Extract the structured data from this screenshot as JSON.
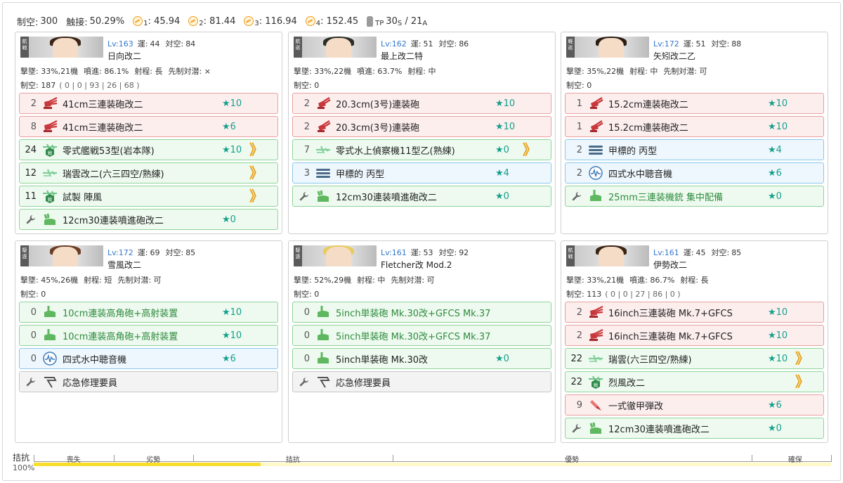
{
  "fleet": {
    "air_power_label": "制空:",
    "air_power": "300",
    "contact_label": "触接:",
    "contact": "50.29%",
    "formations": [
      {
        "sub": "1",
        "value": ": 45.94"
      },
      {
        "sub": "2",
        "value": ": 81.44"
      },
      {
        "sub": "3",
        "value": ": 116.94"
      },
      {
        "sub": "4",
        "value": ": 152.45"
      }
    ],
    "tp_label": "TP",
    "tp_s": "30",
    "tp_s_sub": "S",
    "tp_sep": " / ",
    "tp_a": "21",
    "tp_a_sub": "A"
  },
  "ships": [
    {
      "tag": "航戦",
      "lv": "Lv:163",
      "luck_k": "運:",
      "luck": "44",
      "aa_k": "対空:",
      "aa": "84",
      "name": "日向改二",
      "stats": [
        "撃墜: 33%,21機",
        "噴進: 86.1%",
        "射程: 長",
        "先制対潜: ×"
      ],
      "airpower_label": "制空:",
      "airpower": "187",
      "airpower_detail": "( 0 | 0 | 93 | 26 | 68 )",
      "hair": "#3a2418",
      "slots": [
        {
          "color": "red",
          "count": "2",
          "icon": "main-gun",
          "name": "41cm三連装砲改二",
          "star": "★10",
          "prof": ""
        },
        {
          "color": "red",
          "count": "8",
          "icon": "main-gun",
          "name": "41cm三連装砲改二",
          "star": "★6",
          "prof": ""
        },
        {
          "color": "green",
          "count": "24",
          "icon": "fighter-bomber",
          "name": "零式艦戦53型(岩本隊)",
          "star": "★10",
          "prof": "》"
        },
        {
          "color": "green",
          "count": "12",
          "icon": "seaplane",
          "name": "瑞雲改二(六三四空/熟練)",
          "star": "",
          "prof": "》"
        },
        {
          "color": "green",
          "count": "11",
          "icon": "fighter-bomber",
          "name": "試製 陣風",
          "star": "",
          "prof": "》"
        },
        {
          "color": "green",
          "count": "",
          "icon": "rocket-launcher",
          "name": "12cm30連装噴進砲改二",
          "star": "★0",
          "prof": "",
          "ex": true
        }
      ]
    },
    {
      "tag": "航巡",
      "lv": "Lv:162",
      "luck_k": "運:",
      "luck": "51",
      "aa_k": "対空:",
      "aa": "86",
      "name": "最上改二特",
      "stats": [
        "撃墜: 33%,22機",
        "噴進: 63.7%",
        "射程: 中"
      ],
      "airpower_label": "制空:",
      "airpower": "0",
      "airpower_detail": "",
      "hair": "#2a2e26",
      "slots": [
        {
          "color": "red",
          "count": "2",
          "icon": "medium-gun",
          "name": "20.3cm(3号)連装砲",
          "star": "★10",
          "prof": ""
        },
        {
          "color": "red",
          "count": "2",
          "icon": "medium-gun",
          "name": "20.3cm(3号)連装砲",
          "star": "★10",
          "prof": ""
        },
        {
          "color": "green",
          "count": "7",
          "icon": "seaplane",
          "name": "零式水上偵察機11型乙(熟練)",
          "star": "★0",
          "prof": "》"
        },
        {
          "color": "blue",
          "count": "3",
          "icon": "midget-sub",
          "name": "甲標的 丙型",
          "star": "★4",
          "prof": ""
        },
        {
          "color": "green",
          "count": "",
          "icon": "rocket-launcher",
          "name": "12cm30連装噴進砲改二",
          "star": "★0",
          "prof": "",
          "ex": true
        }
      ]
    },
    {
      "tag": "軽巡",
      "lv": "Lv:172",
      "luck_k": "運:",
      "luck": "51",
      "aa_k": "対空:",
      "aa": "88",
      "name": "矢矧改二乙",
      "stats": [
        "撃墜: 35%,22機",
        "射程: 中",
        "先制対潜: 可"
      ],
      "airpower_label": "制空:",
      "airpower": "0",
      "airpower_detail": "",
      "hair": "#2b1c14",
      "slots": [
        {
          "color": "red",
          "count": "1",
          "icon": "medium-gun",
          "name": "15.2cm連装砲改二",
          "star": "★10",
          "prof": ""
        },
        {
          "color": "red",
          "count": "1",
          "icon": "medium-gun",
          "name": "15.2cm連装砲改二",
          "star": "★10",
          "prof": ""
        },
        {
          "color": "blue",
          "count": "2",
          "icon": "midget-sub",
          "name": "甲標的 丙型",
          "star": "★4",
          "prof": ""
        },
        {
          "color": "blue",
          "count": "2",
          "icon": "sonar",
          "name": "四式水中聴音機",
          "star": "★6",
          "prof": ""
        },
        {
          "color": "green",
          "count": "",
          "icon": "aa-gun",
          "name": "25mm三連装機銃 集中配備",
          "star": "★0",
          "prof": "",
          "ex": true,
          "green_name": true
        }
      ]
    },
    {
      "tag": "駆逐",
      "lv": "Lv:172",
      "luck_k": "運:",
      "luck": "69",
      "aa_k": "対空:",
      "aa": "85",
      "name": "雪風改二",
      "stats": [
        "撃墜: 45%,26機",
        "射程: 短",
        "先制対潜: 可"
      ],
      "airpower_label": "制空:",
      "airpower": "0",
      "airpower_detail": "",
      "hair": "#6a3e26",
      "slots": [
        {
          "color": "green",
          "count": "0",
          "icon": "aa-gun",
          "name": "10cm連装高角砲+高射装置",
          "star": "★10",
          "prof": "",
          "green_name": true
        },
        {
          "color": "green",
          "count": "0",
          "icon": "aa-gun",
          "name": "10cm連装高角砲+高射装置",
          "star": "★10",
          "prof": "",
          "green_name": true
        },
        {
          "color": "blue",
          "count": "0",
          "icon": "sonar",
          "name": "四式水中聴音機",
          "star": "★6",
          "prof": ""
        },
        {
          "color": "gray",
          "count": "",
          "icon": "repair-team",
          "name": "応急修理要員",
          "star": "",
          "prof": "",
          "ex": true
        }
      ]
    },
    {
      "tag": "駆逐",
      "lv": "Lv:161",
      "luck_k": "運:",
      "luck": "53",
      "aa_k": "対空:",
      "aa": "92",
      "name": "Fletcher改 Mod.2",
      "stats": [
        "撃墜: 52%,29機",
        "射程: 中",
        "先制対潜: 可"
      ],
      "airpower_label": "制空:",
      "airpower": "0",
      "airpower_detail": "",
      "hair": "#e8cc60",
      "slots": [
        {
          "color": "green",
          "count": "0",
          "icon": "aa-gun",
          "name": "5inch単装砲 Mk.30改+GFCS Mk.37",
          "star": "",
          "prof": "",
          "green_name": true
        },
        {
          "color": "green",
          "count": "0",
          "icon": "aa-gun",
          "name": "5inch単装砲 Mk.30改+GFCS Mk.37",
          "star": "",
          "prof": "",
          "green_name": true
        },
        {
          "color": "green",
          "count": "0",
          "icon": "aa-gun",
          "name": "5inch単装砲 Mk.30改",
          "star": "★0",
          "prof": ""
        },
        {
          "color": "gray",
          "count": "",
          "icon": "repair-team",
          "name": "応急修理要員",
          "star": "",
          "prof": "",
          "ex": true
        }
      ]
    },
    {
      "tag": "航戦",
      "lv": "Lv:161",
      "luck_k": "運:",
      "luck": "45",
      "aa_k": "対空:",
      "aa": "85",
      "name": "伊勢改二",
      "stats": [
        "撃墜: 33%,21機",
        "噴進: 86.7%",
        "射程: 長"
      ],
      "airpower_label": "制空:",
      "airpower": "113",
      "airpower_detail": "( 0 | 0 | 27 | 86 | 0 )",
      "hair": "#3a2416",
      "slots": [
        {
          "color": "red",
          "count": "2",
          "icon": "main-gun",
          "name": "16inch三連装砲 Mk.7+GFCS",
          "star": "★10",
          "prof": ""
        },
        {
          "color": "red",
          "count": "2",
          "icon": "main-gun",
          "name": "16inch三連装砲 Mk.7+GFCS",
          "star": "★10",
          "prof": ""
        },
        {
          "color": "green",
          "count": "22",
          "icon": "seaplane",
          "name": "瑞雲(六三四空/熟練)",
          "star": "★10",
          "prof": "》"
        },
        {
          "color": "green",
          "count": "22",
          "icon": "fighter-bomber",
          "name": "烈風改二",
          "star": "",
          "prof": "》"
        },
        {
          "color": "red",
          "count": "9",
          "icon": "ap-shell",
          "name": "一式徹甲弾改",
          "star": "★6",
          "prof": ""
        },
        {
          "color": "green",
          "count": "",
          "icon": "rocket-launcher",
          "name": "12cm30連装噴進砲改二",
          "star": "★0",
          "prof": "",
          "ex": true
        }
      ]
    }
  ],
  "gauge": {
    "label": "拮抗",
    "percent": "100%",
    "fill_fraction": 0.285,
    "ticks": [
      {
        "label": "喪失",
        "frac": 0.05
      },
      {
        "label": "劣勢",
        "frac": 0.15
      },
      {
        "label": "拮抗",
        "frac": 0.325
      },
      {
        "label": "優勢",
        "frac": 0.675
      },
      {
        "label": "確保",
        "frac": 0.955
      }
    ],
    "tick_lines": [
      0,
      0.1,
      0.2,
      0.45,
      0.9,
      1.0
    ]
  }
}
